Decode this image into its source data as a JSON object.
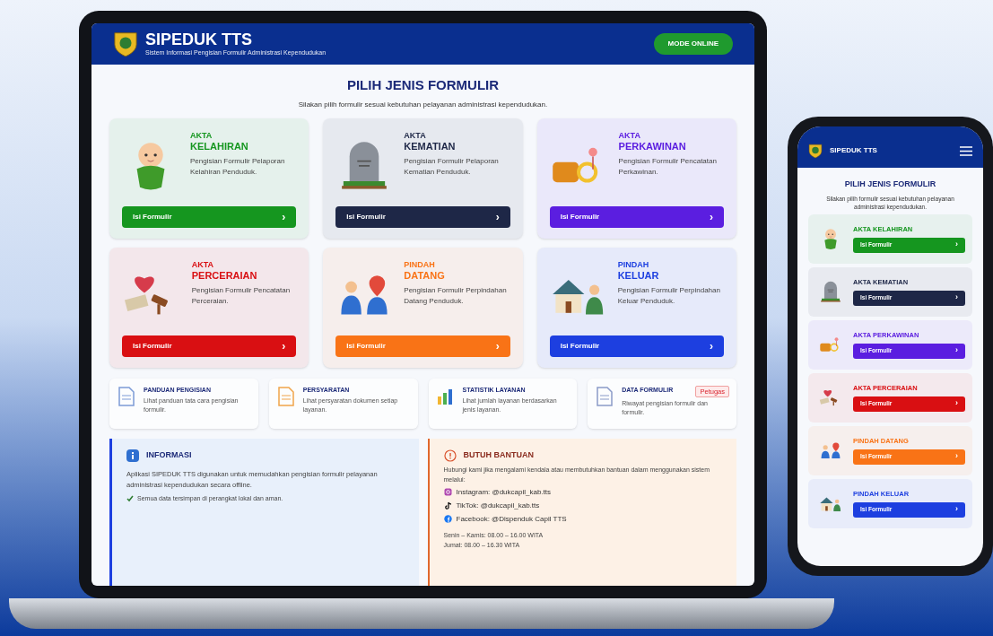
{
  "laptop": {
    "app": {
      "title": "SIPEDUK TTS",
      "subtitle": "Sistem Informasi Pengisian Formulir Administrasi Kependudukan",
      "mode": "MODE ONLINE"
    },
    "heading": "PILIH JENIS FORMULIR",
    "intro": "Silakan pilih formulir sesuai kebutuhan pelayanan administrasi kependudukan.",
    "cards": [
      {
        "kicker": "AKTA",
        "title": "KELAHIRAN",
        "description": "Pengisian Formulir Pelaporan Kelahiran Penduduk.",
        "button": "Isi Formulir",
        "arrow": "›",
        "color": "#15961f"
      },
      {
        "kicker": "AKTA",
        "title": "KEMATIAN",
        "description": "Pengisian Formulir Pelaporan Kematian Penduduk.",
        "button": "Isi Formulir",
        "arrow": "›",
        "color": "#1e2747"
      },
      {
        "kicker": "AKTA",
        "title": "PERKAWINAN",
        "description": "Pengisian Formulir Pencatatan Perkawinan.",
        "button": "Isi Formulir",
        "arrow": "›",
        "color": "#5b1ee0"
      },
      {
        "kicker": "AKTA",
        "title": "PERCERAIAN",
        "description": "Pengisian Formulir Pencatatan Perceraian.",
        "button": "Isi Formulir",
        "arrow": "›",
        "color": "#d90f12"
      },
      {
        "kicker": "PINDAH",
        "title": "DATANG",
        "description": "Pengisian Formulir Perpindahan Datang Penduduk.",
        "button": "Isi Formulir",
        "arrow": "›",
        "color": "#f97316"
      },
      {
        "kicker": "PINDAH",
        "title": "KELUAR",
        "description": "Pengisian Formulir Perpindahan Keluar Penduduk.",
        "button": "Isi Formulir",
        "arrow": "›",
        "color": "#1d3fe0"
      }
    ],
    "tiles": [
      {
        "title": "PANDUAN PENGISIAN",
        "description": "Lihat panduan tata cara pengisian formulir."
      },
      {
        "title": "PERSYARATAN",
        "description": "Lihat persyaratan dokumen setiap layanan."
      },
      {
        "title": "STATISTIK LAYANAN",
        "description": "Lihat jumlah layanan berdasarkan jenis layanan."
      },
      {
        "title": "DATA FORMULIR",
        "badge": "Petugas",
        "description": "Riwayat pengisian formulir dan formulir."
      }
    ],
    "info": {
      "title": "INFORMASI",
      "text": "Aplikasi SIPEDUK TTS digunakan untuk memudahkan pengisian formulir pelayanan administrasi kependudukan secara offline.",
      "note": "Semua data tersimpan di perangkat lokal dan aman."
    },
    "help": {
      "title": "BUTUH BANTUAN",
      "text": "Hubungi kami jika mengalami kendala atau membutuhkan bantuan dalam menggunakan sistem melalui:",
      "contacts": [
        {
          "kind": "instagram",
          "label": "Instagram: @dukcapil_kab.tts"
        },
        {
          "kind": "tiktok",
          "label": "TikTok: @dukcapil_kab.tts"
        },
        {
          "kind": "facebook",
          "label": "Facebook: @Dispenduk Capil TTS"
        }
      ],
      "hours": [
        "Senin – Kamis: 08.00 – 16.00 WITA",
        "Jumat: 08.00 – 16.30 WITA"
      ]
    }
  },
  "phone": {
    "title": "SIPEDUK TTS",
    "heading": "PILIH JENIS FORMULIR",
    "intro": "Silakan pilih formulir sesuai kebutuhan pelayanan administrasi kependudukan.",
    "items": [
      {
        "title": "AKTA KELAHIRAN",
        "button": "Isi Formulir",
        "arrow": "›",
        "color": "#15961f"
      },
      {
        "title": "AKTA KEMATIAN",
        "button": "Isi Formulir",
        "arrow": "›",
        "color": "#1e2747"
      },
      {
        "title": "AKTA PERKAWINAN",
        "button": "Isi Formulir",
        "arrow": "›",
        "color": "#5b1ee0"
      },
      {
        "title": "AKTA PERCERAIAN",
        "button": "Isi Formulir",
        "arrow": "›",
        "color": "#d90f12"
      },
      {
        "title": "PINDAH DATANG",
        "button": "Isi Formulir",
        "arrow": "›",
        "color": "#f97316"
      },
      {
        "title": "PINDAH KELUAR",
        "button": "Isi Formulir",
        "arrow": "›",
        "color": "#1d3fe0"
      }
    ]
  }
}
